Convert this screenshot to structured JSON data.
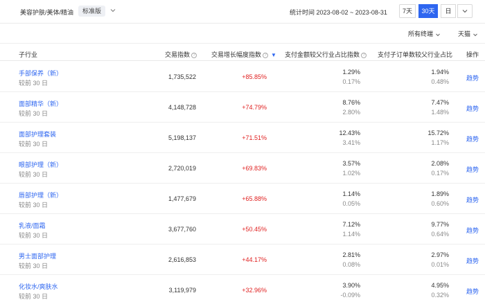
{
  "header": {
    "breadcrumb": "美容护肤/美体/精油",
    "version_badge": "标准版",
    "period": "统计时间 2023-08-02 ~ 2023-08-31",
    "range_buttons": [
      "7天",
      "30天",
      "日"
    ],
    "active_range": "30天"
  },
  "filters": {
    "terminal": "所有终端",
    "platform": "天猫"
  },
  "table": {
    "headers": {
      "category": "子行业",
      "trade_index": "交易指数",
      "growth": "交易增长幅度指数",
      "pay_share": "支付金额较父行业占比指数",
      "order_share": "支付子订单数较父行业占比",
      "action": "操作"
    },
    "rows": [
      {
        "name": "手部保养（新）",
        "sub": "较前 30 日",
        "index": "1,735,522",
        "growth": "+85.85%",
        "pay": "1.29%",
        "pay_prev": "0.17%",
        "order": "1.94%",
        "order_prev": "0.48%",
        "action": "趋势"
      },
      {
        "name": "面部精华（新）",
        "sub": "较前 30 日",
        "index": "4,148,728",
        "growth": "+74.79%",
        "pay": "8.76%",
        "pay_prev": "2.80%",
        "order": "7.47%",
        "order_prev": "1.48%",
        "action": "趋势"
      },
      {
        "name": "面部护理套装",
        "sub": "较前 30 日",
        "index": "5,198,137",
        "growth": "+71.51%",
        "pay": "12.43%",
        "pay_prev": "3.41%",
        "order": "15.72%",
        "order_prev": "1.17%",
        "action": "趋势"
      },
      {
        "name": "眼部护理（新）",
        "sub": "较前 30 日",
        "index": "2,720,019",
        "growth": "+69.83%",
        "pay": "3.57%",
        "pay_prev": "1.02%",
        "order": "2.08%",
        "order_prev": "0.17%",
        "action": "趋势"
      },
      {
        "name": "唇部护理（新）",
        "sub": "较前 30 日",
        "index": "1,477,679",
        "growth": "+65.88%",
        "pay": "1.14%",
        "pay_prev": "0.05%",
        "order": "1.89%",
        "order_prev": "0.60%",
        "action": "趋势"
      },
      {
        "name": "乳液/面霜",
        "sub": "较前 30 日",
        "index": "3,677,760",
        "growth": "+50.45%",
        "pay": "7.12%",
        "pay_prev": "1.14%",
        "order": "9.77%",
        "order_prev": "0.64%",
        "action": "趋势"
      },
      {
        "name": "男士面部护理",
        "sub": "较前 30 日",
        "index": "2,616,853",
        "growth": "+44.17%",
        "pay": "2.81%",
        "pay_prev": "0.08%",
        "order": "2.97%",
        "order_prev": "0.01%",
        "action": "趋势"
      },
      {
        "name": "化妆水/爽肤水",
        "sub": "较前 30 日",
        "index": "3,119,979",
        "growth": "+32.96%",
        "pay": "3.90%",
        "pay_prev": "-0.09%",
        "order": "4.95%",
        "order_prev": "0.32%",
        "action": "趋势"
      }
    ]
  },
  "colors": {
    "accent": "#2e66f0",
    "growth": "#e02020"
  }
}
